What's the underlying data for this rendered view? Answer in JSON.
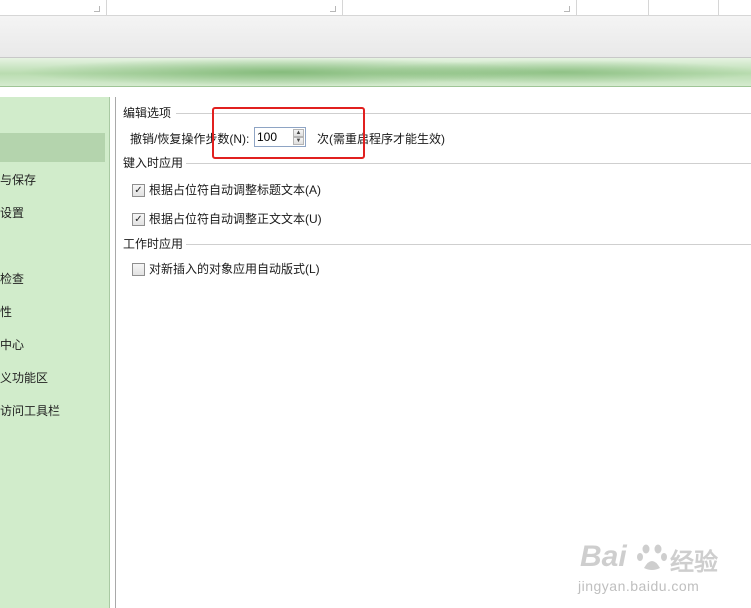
{
  "sidebar": {
    "items": [
      {
        "label": ""
      },
      {
        "label": "与保存"
      },
      {
        "label": "设置"
      },
      {
        "label": "检查"
      },
      {
        "label": "性"
      },
      {
        "label": "中心"
      },
      {
        "label": "义功能区"
      },
      {
        "label": "访问工具栏"
      }
    ]
  },
  "edit_options": {
    "title": "编辑选项",
    "undo_label": "撤销/恢复操作步数(N):",
    "undo_value": "100",
    "undo_suffix": "次(需重启程序才能生效)"
  },
  "typing_apply": {
    "title": "键入时应用",
    "options": [
      {
        "label": "根据占位符自动调整标题文本(A)",
        "checked": true
      },
      {
        "label": "根据占位符自动调整正文文本(U)",
        "checked": true
      }
    ]
  },
  "working_apply": {
    "title": "工作时应用",
    "options": [
      {
        "label": "对新插入的对象应用自动版式(L)",
        "checked": false
      }
    ]
  },
  "watermark": {
    "brand": "Bai",
    "brand_suffix": "经验",
    "url": "jingyan.baidu.com"
  },
  "colors": {
    "sidebar_bg": "#d1eccb",
    "highlight": "#e1201f"
  }
}
